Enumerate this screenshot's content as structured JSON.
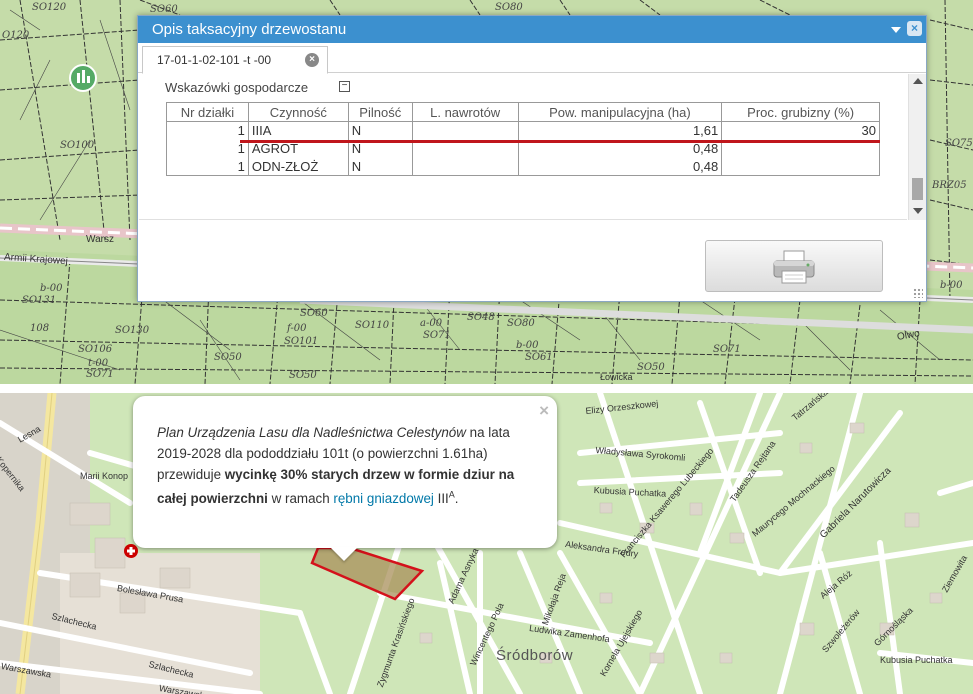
{
  "dialog": {
    "title": "Opis taksacyjny drzewostanu",
    "tab_label": "17-01-1-02-101 -t -00",
    "section_title": "Wskazówki gospodarcze",
    "collapse_symbol": "−",
    "columns": [
      "Nr działki",
      "Czynność",
      "Pilność",
      "L. nawrotów",
      "Pow. manipulacyjna (ha)",
      "Proc. grubizny (%)"
    ],
    "rows": [
      [
        "1",
        "IIIA",
        "N",
        "",
        "1,61",
        "30"
      ],
      [
        "1",
        "AGROT",
        "N",
        "",
        "0,48",
        ""
      ],
      [
        "1",
        "ODN-ZŁOŻ",
        "N",
        "",
        "0,48",
        ""
      ]
    ],
    "print_icon": "printer-icon"
  },
  "map_top": {
    "road_labels": [
      "Warsz",
      "Armii Krajowej",
      "Olwo"
    ],
    "parcel_labels": [
      "SO120",
      "O120",
      "SO100",
      "b-00",
      "SO131",
      "108",
      "SO130",
      "SO106",
      "SO71",
      "SO50",
      "SO101",
      "SO50",
      "SO60",
      "SO110",
      "SO71",
      "SO48",
      "SO80",
      "SO61",
      "SO71",
      "SO50",
      "SO75",
      "BRZ05",
      "b-00",
      "SO60",
      "SO80",
      "f-00",
      "b-00",
      "a-00",
      "t-00",
      "Łowicka"
    ]
  },
  "map_bottom": {
    "streets": [
      "Lesna",
      "Kopernika",
      "Marii Konop",
      "Bolesława Prusa",
      "Szlachecka",
      "Szlachecka",
      "Warszawska",
      "Warszawska",
      "Elizy Orzeszkowej",
      "Władysława Syrokomli",
      "Kubusia Puchatka",
      "Aleksandra Fredry",
      "Franciszka Ksawerego Lubeckiego",
      "Tadeusza Rejtana",
      "Maurycego Mochnackiego",
      "Gabriela Narutowicza",
      "Tatrzańska",
      "Aleja Róż",
      "Szwoleżerów",
      "Ziemowita",
      "Górnośląska",
      "Kubusia Puchatka",
      "Ludwika Zamenhofa",
      "Kornela Ujejskiego",
      "Mikołaja Reja",
      "Wincentego Pola",
      "Adama Asnyka",
      "Zygmunta Krasińskiego"
    ],
    "district": "Śródborów"
  },
  "popup": {
    "p1": "Plan Urządzenia Lasu dla Nadleśnictwa Celestynów",
    "p2": " na lata 2019-2028 dla pododdziału 101t (o powierzchni 1.61ha) przewiduje ",
    "p3": "wycinkę 30% starych drzew w formie dziur na całej powierzchni",
    "p4": " w ramach ",
    "link": "rębni gniazdowej",
    "p5": " III",
    "sup": "A",
    "p6": ".",
    "close": "×"
  },
  "colors": {
    "header_blue": "#3c90cf",
    "highlight_red": "#c0161c",
    "map_green": "#c9dfb0",
    "parcel_fill": "#a88f5a"
  }
}
